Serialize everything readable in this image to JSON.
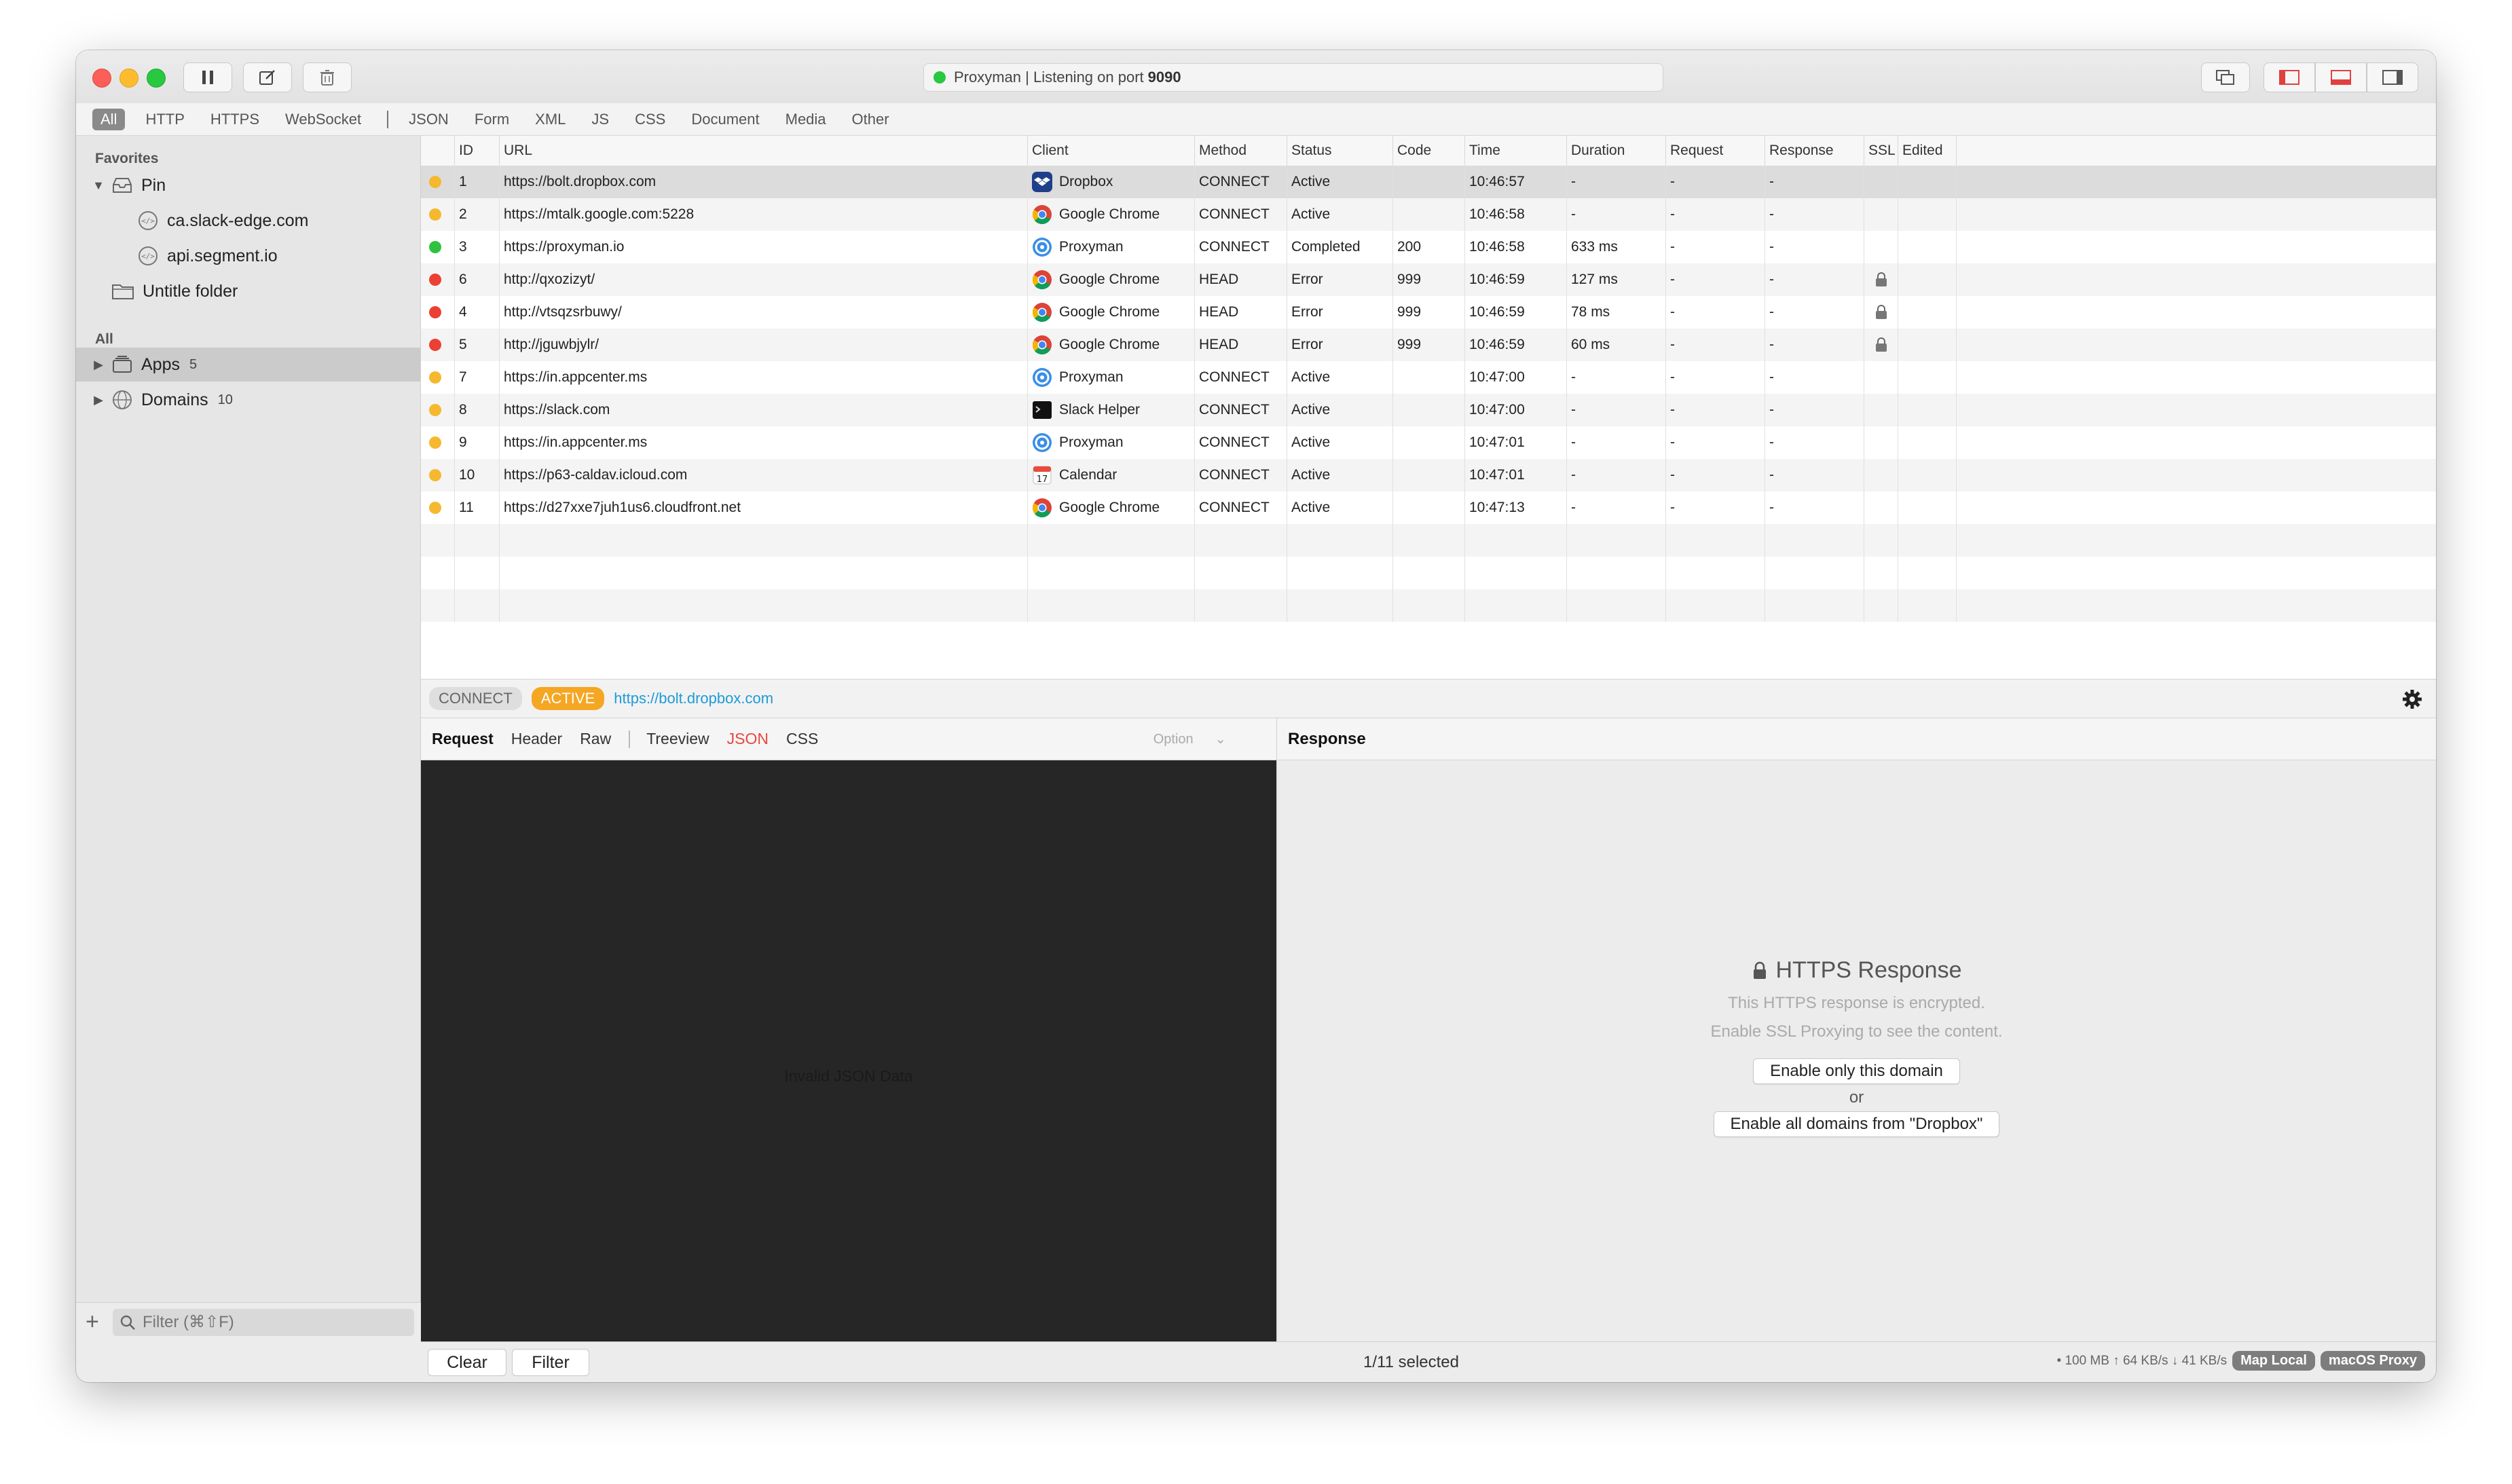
{
  "titlebar": {
    "status_prefix": "Proxyman | Listening on port",
    "port": "9090"
  },
  "filters": [
    "All",
    "HTTP",
    "HTTPS",
    "WebSocket",
    "JSON",
    "Form",
    "XML",
    "JS",
    "CSS",
    "Document",
    "Media",
    "Other"
  ],
  "sidebar": {
    "favorites_heading": "Favorites",
    "pin_label": "Pin",
    "pinned": [
      "ca.slack-edge.com",
      "api.segment.io"
    ],
    "folder_label": "Untitle folder",
    "all_heading": "All",
    "apps_label": "Apps",
    "apps_count": "5",
    "domains_label": "Domains",
    "domains_count": "10",
    "filter_placeholder": "Filter (⌘⇧F)"
  },
  "table": {
    "columns": [
      "ID",
      "URL",
      "Client",
      "Method",
      "Status",
      "Code",
      "Time",
      "Duration",
      "Request",
      "Response",
      "SSL",
      "Edited"
    ],
    "rows": [
      {
        "dot": "#f5b82e",
        "id": "1",
        "url": "https://bolt.dropbox.com",
        "client": "Dropbox",
        "icon": "dropbox",
        "method": "CONNECT",
        "status": "Active",
        "code": "",
        "time": "10:46:57",
        "duration": "-",
        "request": "-",
        "response": "-",
        "ssl": false
      },
      {
        "dot": "#f5b82e",
        "id": "2",
        "url": "https://mtalk.google.com:5228",
        "client": "Google Chrome",
        "icon": "chrome",
        "method": "CONNECT",
        "status": "Active",
        "code": "",
        "time": "10:46:58",
        "duration": "-",
        "request": "-",
        "response": "-",
        "ssl": false
      },
      {
        "dot": "#2fc23f",
        "id": "3",
        "url": "https://proxyman.io",
        "client": "Proxyman",
        "icon": "proxyman",
        "method": "CONNECT",
        "status": "Completed",
        "code": "200",
        "time": "10:46:58",
        "duration": "633 ms",
        "request": "-",
        "response": "-",
        "ssl": false
      },
      {
        "dot": "#ec4034",
        "id": "6",
        "url": "http://qxozizyt/",
        "client": "Google Chrome",
        "icon": "chrome",
        "method": "HEAD",
        "status": "Error",
        "code": "999",
        "time": "10:46:59",
        "duration": "127 ms",
        "request": "-",
        "response": "-",
        "ssl": true
      },
      {
        "dot": "#ec4034",
        "id": "4",
        "url": "http://vtsqzsrbuwy/",
        "client": "Google Chrome",
        "icon": "chrome",
        "method": "HEAD",
        "status": "Error",
        "code": "999",
        "time": "10:46:59",
        "duration": "78 ms",
        "request": "-",
        "response": "-",
        "ssl": true
      },
      {
        "dot": "#ec4034",
        "id": "5",
        "url": "http://jguwbjylr/",
        "client": "Google Chrome",
        "icon": "chrome",
        "method": "HEAD",
        "status": "Error",
        "code": "999",
        "time": "10:46:59",
        "duration": "60 ms",
        "request": "-",
        "response": "-",
        "ssl": true
      },
      {
        "dot": "#f5b82e",
        "id": "7",
        "url": "https://in.appcenter.ms",
        "client": "Proxyman",
        "icon": "proxyman",
        "method": "CONNECT",
        "status": "Active",
        "code": "",
        "time": "10:47:00",
        "duration": "-",
        "request": "-",
        "response": "-",
        "ssl": false
      },
      {
        "dot": "#f5b82e",
        "id": "8",
        "url": "https://slack.com",
        "client": "Slack Helper",
        "icon": "terminal",
        "method": "CONNECT",
        "status": "Active",
        "code": "",
        "time": "10:47:00",
        "duration": "-",
        "request": "-",
        "response": "-",
        "ssl": false
      },
      {
        "dot": "#f5b82e",
        "id": "9",
        "url": "https://in.appcenter.ms",
        "client": "Proxyman",
        "icon": "proxyman",
        "method": "CONNECT",
        "status": "Active",
        "code": "",
        "time": "10:47:01",
        "duration": "-",
        "request": "-",
        "response": "-",
        "ssl": false
      },
      {
        "dot": "#f5b82e",
        "id": "10",
        "url": "https://p63-caldav.icloud.com",
        "client": "Calendar",
        "icon": "calendar",
        "method": "CONNECT",
        "status": "Active",
        "code": "",
        "time": "10:47:01",
        "duration": "-",
        "request": "-",
        "response": "-",
        "ssl": false
      },
      {
        "dot": "#f5b82e",
        "id": "11",
        "url": "https://d27xxe7juh1us6.cloudfront.net",
        "client": "Google Chrome",
        "icon": "chrome",
        "method": "CONNECT",
        "status": "Active",
        "code": "",
        "time": "10:47:13",
        "duration": "-",
        "request": "-",
        "response": "-",
        "ssl": false
      }
    ]
  },
  "detail": {
    "method": "CONNECT",
    "state": "ACTIVE",
    "url": "https://bolt.dropbox.com"
  },
  "request_panel": {
    "title": "Request",
    "tabs": [
      "Header",
      "Raw"
    ],
    "format_tabs": [
      "Treeview",
      "JSON",
      "CSS"
    ],
    "option_label": "Option",
    "body_message": "Invalid JSON Data"
  },
  "response_panel": {
    "title": "Response",
    "heading": "HTTPS Response",
    "line1": "This HTTPS response is encrypted.",
    "line2": "Enable SSL Proxying to see the content.",
    "enable_domain": "Enable only this domain",
    "or": "or",
    "enable_all": "Enable all domains from \"Dropbox\""
  },
  "bottombar": {
    "clear": "Clear",
    "filter": "Filter",
    "selection": "1/11 selected",
    "stats": "• 100 MB ↑ 64 KB/s ↓ 41 KB/s",
    "map_local": "Map Local",
    "macos_proxy": "macOS Proxy"
  },
  "colors": {
    "active_badge": "#f5a623",
    "url_link": "#1e9bd7",
    "json_tab": "#e8473f"
  }
}
